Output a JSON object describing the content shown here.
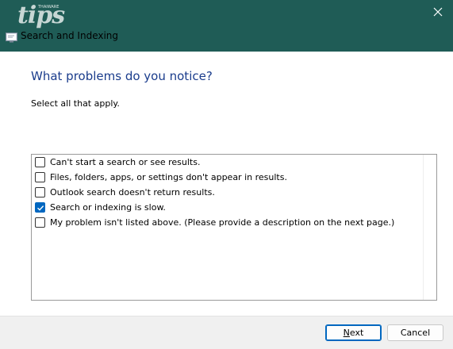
{
  "window": {
    "title": "Search and Indexing",
    "watermark": "tips",
    "watermark_small": "THAIWARE",
    "close_icon": "close-icon",
    "app_icon": "troubleshooter-icon"
  },
  "page": {
    "heading": "What problems do you notice?",
    "instruction": "Select all that apply."
  },
  "options": [
    {
      "label": "Can't start a search or see results.",
      "checked": false
    },
    {
      "label": "Files, folders, apps, or settings don't appear in results.",
      "checked": false
    },
    {
      "label": "Outlook search doesn't return results.",
      "checked": false
    },
    {
      "label": "Search or indexing is slow.",
      "checked": true
    },
    {
      "label": "My problem isn't listed above. (Please provide a description on the next page.)",
      "checked": false
    }
  ],
  "footer": {
    "next_first": "N",
    "next_rest": "ext",
    "cancel_label": "Cancel"
  },
  "colors": {
    "titlebar": "#1f5c56",
    "heading": "#1a3c8c",
    "accent": "#0067c0"
  }
}
